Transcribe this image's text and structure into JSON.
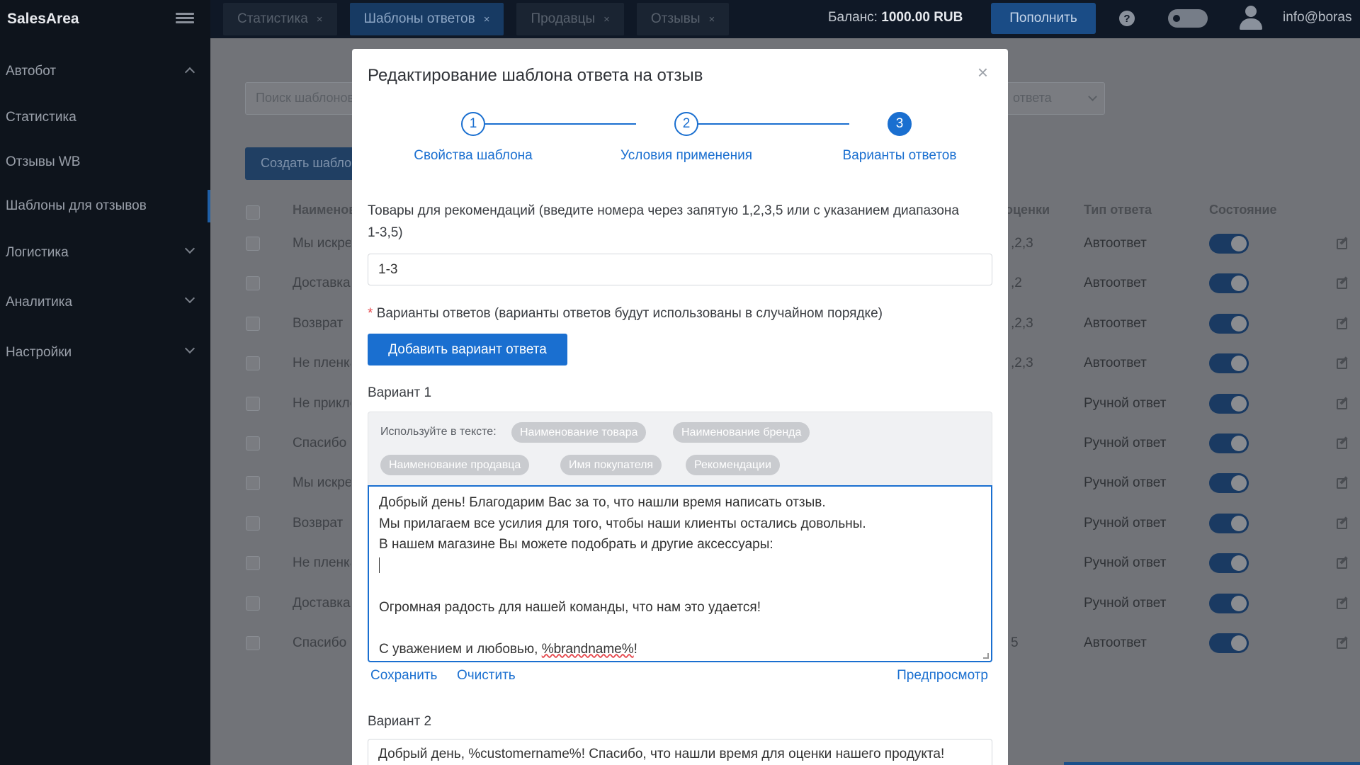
{
  "app": {
    "name": "SalesArea"
  },
  "sidebar": {
    "items": [
      {
        "label": "Автобот"
      },
      {
        "label": "Статистика"
      },
      {
        "label": "Отзывы WB"
      },
      {
        "label": "Шаблоны для отзывов"
      },
      {
        "label": "Логистика"
      },
      {
        "label": "Аналитика"
      },
      {
        "label": "Настройки"
      }
    ]
  },
  "topbar": {
    "tabs": [
      {
        "label": "Статистика",
        "close": "×"
      },
      {
        "label": "Шаблоны ответов",
        "close": "×"
      },
      {
        "label": "Продавцы",
        "close": "×"
      },
      {
        "label": "Отзывы",
        "close": "×"
      }
    ],
    "balance_label": "Баланс:",
    "balance_value": "1000.00 RUB",
    "topup_label": "Пополнить",
    "help_glyph": "?",
    "email": "info@boras"
  },
  "background_page": {
    "search_placeholder": "Поиск шаблонов",
    "create_button": "Создать шаблон",
    "type_select_fragment": "ответа",
    "headers": {
      "name": "Наименование",
      "rating": "оценки",
      "type": "Тип ответа",
      "state": "Состояние"
    },
    "rows": [
      {
        "name": "Мы искренне",
        "rating": ",2,3",
        "type": "Автоответ"
      },
      {
        "name": "Доставка",
        "rating": ",2",
        "type": "Автоответ"
      },
      {
        "name": "Возврат",
        "rating": ",2,3",
        "type": "Автоответ"
      },
      {
        "name": "Не пленка",
        "rating": ",2,3",
        "type": "Автоответ"
      },
      {
        "name": "Не приклеивается",
        "rating": "",
        "type": "Ручной ответ"
      },
      {
        "name": "Спасибо",
        "rating": "",
        "type": "Ручной ответ"
      },
      {
        "name": "Мы искренне",
        "rating": "",
        "type": "Ручной ответ"
      },
      {
        "name": "Возврат",
        "rating": "",
        "type": "Ручной ответ"
      },
      {
        "name": "Не пленка",
        "rating": "",
        "type": "Ручной ответ"
      },
      {
        "name": "Доставка",
        "rating": "",
        "type": "Ручной ответ"
      },
      {
        "name": "Спасибо",
        "rating": "5",
        "type": "Автоответ"
      }
    ]
  },
  "modal": {
    "title": "Редактирование шаблона ответа на отзыв",
    "close_glyph": "×",
    "steps": [
      {
        "number": "1",
        "label": "Свойства шаблона"
      },
      {
        "number": "2",
        "label": "Условия применения"
      },
      {
        "number": "3",
        "label": "Варианты ответов"
      }
    ],
    "products_label": "Товары для рекомендаций (введите номера через запятую 1,2,3,5 или с указанием диапазона 1-3,5)",
    "products_value": "1-3",
    "variants_required_mark": "*",
    "variants_label": "Варианты ответов (варианты ответов будут использованы в случайном порядке)",
    "add_variant_label": "Добавить вариант ответа",
    "variant1": {
      "title": "Вариант 1",
      "tag_hint": "Используйте в тексте:",
      "tags": [
        "Наименование товара",
        "Наименование бренда",
        "Наименование продавца",
        "Имя покупателя",
        "Рекомендации"
      ],
      "lines": [
        "Добрый день! Благодарим Вас за то, что нашли время написать отзыв.",
        "Мы прилагаем все усилия для того, чтобы наши клиенты остались довольны.",
        "В нашем магазине Вы можете подобрать и другие аксессуары:",
        "",
        "",
        "Огромная радость для нашей команды, что нам это удается!",
        "",
        "С уважением и любовью, "
      ],
      "brand_token": "%brandname%",
      "closing_punct": "!",
      "save_label": "Сохранить",
      "clear_label": "Очистить",
      "preview_label": "Предпросмотр"
    },
    "variant2": {
      "title": "Вариант 2",
      "text": "Добрый день, %customername%! Спасибо, что нашли время для оценки нашего продукта!"
    }
  }
}
